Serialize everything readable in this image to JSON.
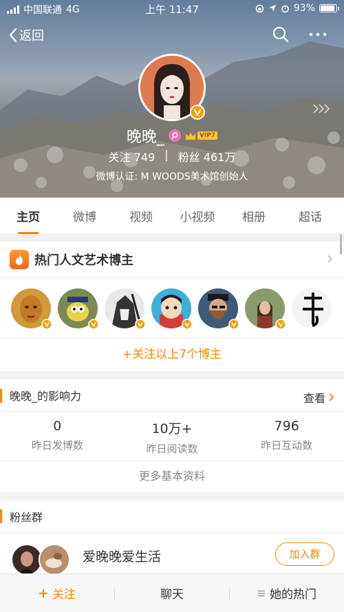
{
  "status_bar": {
    "carrier": "中国联通",
    "network": "4G",
    "time": "上午 11:47",
    "battery_text": "93%",
    "battery_level": 0.93
  },
  "nav": {
    "back_label": "返回",
    "icons": [
      "back-chevron-icon",
      "search-icon",
      "more-icon"
    ]
  },
  "profile": {
    "name": "晚晚_",
    "vip_label": "VIP7",
    "follow_label": "关注",
    "follow_count": "749",
    "divider": "|",
    "fans_label": "粉丝",
    "fans_count": "461万",
    "certification": "微博认证: M WOODS美术馆创始人"
  },
  "tabs": [
    {
      "label": "主页",
      "active": true
    },
    {
      "label": "微博"
    },
    {
      "label": "视频"
    },
    {
      "label": "小视频"
    },
    {
      "label": "相册"
    },
    {
      "label": "超话"
    }
  ],
  "hot_bloggers": {
    "title": "热门人文艺术博主",
    "follow_all": "+关注以上7个博主"
  },
  "influence": {
    "title": "晚晚_的影响力",
    "view_label": "查看",
    "stats": [
      {
        "value": "0",
        "label": "昨日发博数"
      },
      {
        "value": "10万+",
        "label": "昨日阅读数"
      },
      {
        "value": "796",
        "label": "昨日互动数"
      }
    ],
    "more_info": "更多基本资料"
  },
  "fan_group": {
    "title": "粉丝群",
    "group_name": "爱晚晚爱生活",
    "join_label": "加入群"
  },
  "bottom_bar": {
    "follow_label": "关注",
    "chat_label": "聊天",
    "hot_label": "她的热门"
  },
  "colors": {
    "accent": "#ff8200",
    "vip_gold": "#fcc33a",
    "verified": "#f4a000"
  }
}
